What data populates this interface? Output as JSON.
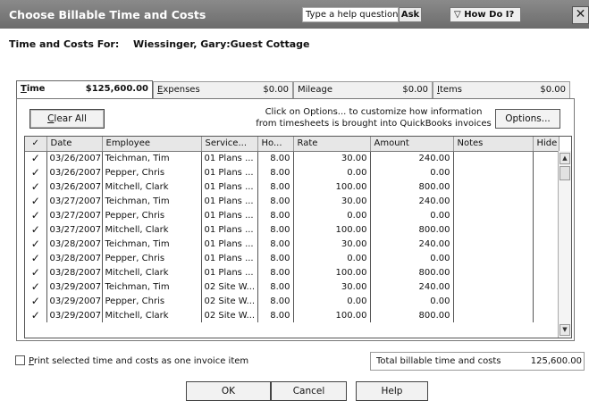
{
  "window": {
    "title": "Choose Billable Time and Costs",
    "help_placeholder": "Type a help question",
    "ask_label": "Ask",
    "how_do_i_label": "How Do I?",
    "close_glyph": "✕"
  },
  "customer": {
    "label": "Time and Costs For:",
    "name": "Wiessinger, Gary:Guest Cottage"
  },
  "tabs": [
    {
      "label_u": "T",
      "label_rest": "ime",
      "amount": "$125,600.00",
      "active": true
    },
    {
      "label_u": "E",
      "label_rest": "xpenses",
      "amount": "$0.00",
      "active": false
    },
    {
      "label_u": "",
      "label_rest": "Mileage",
      "amount": "$0.00",
      "active": false
    },
    {
      "label_u": "I",
      "label_rest": "tems",
      "amount": "$0.00",
      "active": false
    }
  ],
  "toolbar": {
    "clear_all_u": "C",
    "clear_all_rest": "lear All",
    "note": "Click on Options... to customize how information from timesheets is brought into QuickBooks invoices",
    "options_label": "Options..."
  },
  "table": {
    "headers": [
      "✓",
      "Date",
      "Employee",
      "Service...",
      "Ho...",
      "Rate",
      "Amount",
      "Notes",
      "Hide"
    ],
    "rows": [
      {
        "check": "✓",
        "date": "03/26/2007",
        "employee": "Teichman, Tim",
        "service": "01 Plans ...",
        "hours": "8.00",
        "rate": "30.00",
        "amount": "240.00"
      },
      {
        "check": "✓",
        "date": "03/26/2007",
        "employee": "Pepper, Chris",
        "service": "01 Plans ...",
        "hours": "8.00",
        "rate": "0.00",
        "amount": "0.00"
      },
      {
        "check": "✓",
        "date": "03/26/2007",
        "employee": "Mitchell, Clark",
        "service": "01 Plans ...",
        "hours": "8.00",
        "rate": "100.00",
        "amount": "800.00"
      },
      {
        "check": "✓",
        "date": "03/27/2007",
        "employee": "Teichman, Tim",
        "service": "01 Plans ...",
        "hours": "8.00",
        "rate": "30.00",
        "amount": "240.00"
      },
      {
        "check": "✓",
        "date": "03/27/2007",
        "employee": "Pepper, Chris",
        "service": "01 Plans ...",
        "hours": "8.00",
        "rate": "0.00",
        "amount": "0.00"
      },
      {
        "check": "✓",
        "date": "03/27/2007",
        "employee": "Mitchell, Clark",
        "service": "01 Plans ...",
        "hours": "8.00",
        "rate": "100.00",
        "amount": "800.00"
      },
      {
        "check": "✓",
        "date": "03/28/2007",
        "employee": "Teichman, Tim",
        "service": "01 Plans ...",
        "hours": "8.00",
        "rate": "30.00",
        "amount": "240.00"
      },
      {
        "check": "✓",
        "date": "03/28/2007",
        "employee": "Pepper, Chris",
        "service": "01 Plans ...",
        "hours": "8.00",
        "rate": "0.00",
        "amount": "0.00"
      },
      {
        "check": "✓",
        "date": "03/28/2007",
        "employee": "Mitchell, Clark",
        "service": "01 Plans ...",
        "hours": "8.00",
        "rate": "100.00",
        "amount": "800.00"
      },
      {
        "check": "✓",
        "date": "03/29/2007",
        "employee": "Teichman, Tim",
        "service": "02 Site W...",
        "hours": "8.00",
        "rate": "30.00",
        "amount": "240.00"
      },
      {
        "check": "✓",
        "date": "03/29/2007",
        "employee": "Pepper, Chris",
        "service": "02 Site W...",
        "hours": "8.00",
        "rate": "0.00",
        "amount": "0.00"
      },
      {
        "check": "✓",
        "date": "03/29/2007",
        "employee": "Mitchell, Clark",
        "service": "02 Site W...",
        "hours": "8.00",
        "rate": "100.00",
        "amount": "800.00"
      }
    ]
  },
  "footer": {
    "print_u": "P",
    "print_rest": "rint selected time and costs as one invoice item",
    "total_label": "Total billable time and costs",
    "total_value": "125,600.00",
    "ok_label": "OK",
    "cancel_label": "Cancel",
    "help_label": "Help"
  }
}
